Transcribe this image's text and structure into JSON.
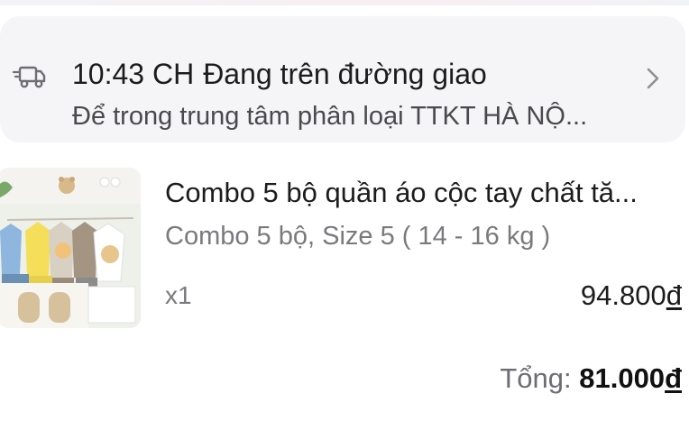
{
  "tracking": {
    "time": "10:43 CH",
    "status": "Đang trên đường giao",
    "detail": "Để trong trung tâm phân loại TTKT HÀ NỘ..."
  },
  "product": {
    "title": "Combo 5 bộ quần áo cộc tay chất tă...",
    "variant": "Combo 5 bộ, Size 5 ( 14 - 16 kg )",
    "quantity": "x1",
    "price": "94.800",
    "currency": "đ"
  },
  "order": {
    "total_label": "Tổng:",
    "total_value": "81.000",
    "currency": "đ"
  },
  "icons": {
    "truck": "truck-icon",
    "chevron": "chevron-right-icon"
  }
}
